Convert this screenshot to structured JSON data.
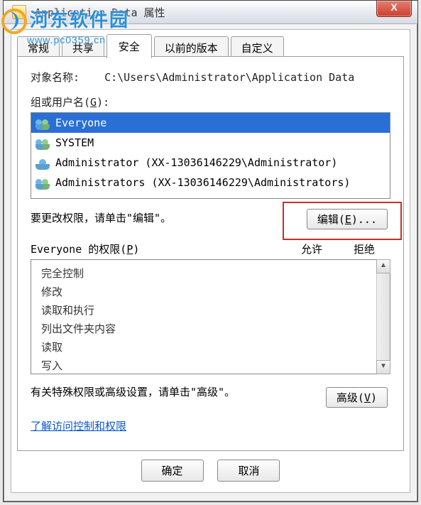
{
  "watermark": {
    "text": "河东软件园",
    "sub": "www.pc0359.cn"
  },
  "titlebar": {
    "title": "Application Data 属性",
    "close": "X"
  },
  "tabs": [
    {
      "label": "常规"
    },
    {
      "label": "共享"
    },
    {
      "label": "安全",
      "active": true
    },
    {
      "label": "以前的版本"
    },
    {
      "label": "自定义"
    }
  ],
  "object": {
    "label": "对象名称:",
    "value": "C:\\Users\\Administrator\\Application Data"
  },
  "groups": {
    "label": "组或用户名(G):",
    "accel": "G",
    "items": [
      {
        "name": "Everyone",
        "selected": true,
        "type": "group"
      },
      {
        "name": "SYSTEM",
        "type": "group"
      },
      {
        "name": "Administrator (XX-13036146229\\Administrator)",
        "type": "user"
      },
      {
        "name": "Administrators (XX-13036146229\\Administrators)",
        "type": "group"
      }
    ]
  },
  "edit": {
    "hint": "要更改权限，请单击\"编辑\"。",
    "button": "编辑(E)...",
    "accel": "E"
  },
  "permissions": {
    "header": {
      "label_prefix": "Everyone 的权限(",
      "accel": "P",
      "label_suffix": ")",
      "allow": "允许",
      "deny": "拒绝"
    },
    "items": [
      {
        "name": "完全控制"
      },
      {
        "name": "修改"
      },
      {
        "name": "读取和执行"
      },
      {
        "name": "列出文件夹内容"
      },
      {
        "name": "读取"
      },
      {
        "name": "写入"
      }
    ]
  },
  "advanced": {
    "hint": "有关特殊权限或高级设置，请单击\"高级\"。",
    "button": "高级(V)",
    "accel": "V"
  },
  "link": {
    "text": "了解访问控制和权限"
  },
  "footer": {
    "ok": "确定",
    "cancel": "取消"
  }
}
